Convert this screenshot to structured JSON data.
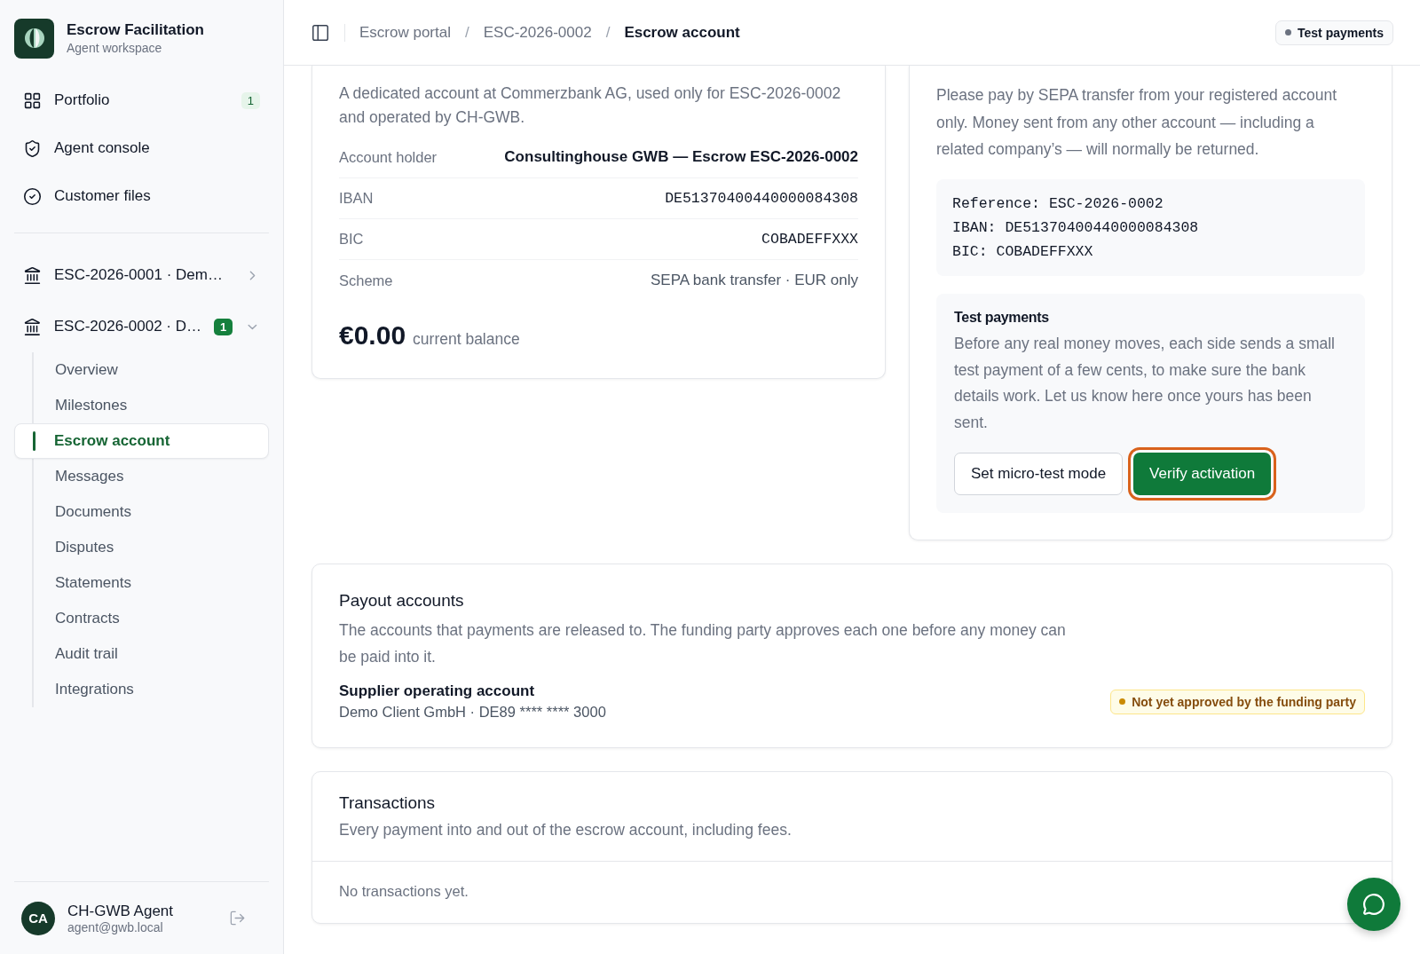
{
  "sidebar": {
    "brand": {
      "title": "Escrow Facilitation",
      "subtitle": "Agent workspace"
    },
    "nav": [
      {
        "label": "Portfolio",
        "badge": "1"
      },
      {
        "label": "Agent console"
      },
      {
        "label": "Customer files"
      }
    ],
    "projects": [
      {
        "label": "ESC-2026-0001 · Dem…",
        "expanded": false
      },
      {
        "label": "ESC-2026-0002 · D…",
        "badge": "1",
        "expanded": true,
        "children": [
          {
            "label": "Overview",
            "selected": false
          },
          {
            "label": "Milestones",
            "selected": false
          },
          {
            "label": "Escrow account",
            "selected": true
          },
          {
            "label": "Messages",
            "selected": false
          },
          {
            "label": "Documents",
            "selected": false
          },
          {
            "label": "Disputes",
            "selected": false
          },
          {
            "label": "Statements",
            "selected": false
          },
          {
            "label": "Contracts",
            "selected": false
          },
          {
            "label": "Audit trail",
            "selected": false
          },
          {
            "label": "Integrations",
            "selected": false
          }
        ]
      }
    ],
    "user": {
      "initials": "CA",
      "name": "CH-GWB Agent",
      "email": "agent@gwb.local"
    }
  },
  "header": {
    "breadcrumbs": [
      "Escrow portal",
      "ESC-2026-0002",
      "Escrow account"
    ],
    "mode_badge": "Test payments",
    "separator": "/"
  },
  "escrow_account": {
    "description": "A dedicated account at Commerzbank AG, used only for ESC-2026-0002 and operated by CH-GWB.",
    "fields": [
      {
        "label": "Account holder",
        "value": "Consultinghouse GWB — Escrow ESC-2026-0002",
        "kind": "strong"
      },
      {
        "label": "IBAN",
        "value": "DE51370400440000084308",
        "kind": "mono"
      },
      {
        "label": "BIC",
        "value": "COBADEFFXXX",
        "kind": "mono"
      },
      {
        "label": "Scheme",
        "value": "SEPA bank transfer · EUR only",
        "kind": "plain"
      }
    ],
    "balance": {
      "amount": "€0.00",
      "caption": "current balance"
    }
  },
  "funding_instructions": {
    "text": "Please pay by SEPA transfer from your registered account only. Money sent from any other account — including a related company’s — will normally be returned.",
    "reference_lines": [
      "Reference: ESC-2026-0002",
      "IBAN: DE51370400440000084308",
      "BIC: COBADEFFXXX"
    ],
    "test_payments": {
      "title": "Test payments",
      "text": "Before any real money moves, each side sends a small test payment of a few cents, to make sure the bank details work. Let us know here once yours has been sent.",
      "buttons": [
        {
          "label": "Set micro-test mode",
          "kind": "secondary",
          "focused": false
        },
        {
          "label": "Verify activation",
          "kind": "primary",
          "focused": true
        }
      ]
    }
  },
  "payout_accounts": {
    "title": "Payout accounts",
    "description": "The accounts that payments are released to. The funding party approves each one before any money can be paid into it.",
    "accounts": [
      {
        "name": "Supplier operating account",
        "detail": "Demo Client GmbH · DE89 **** **** 3000",
        "status": "Not yet approved by the funding party"
      }
    ]
  },
  "transactions": {
    "title": "Transactions",
    "description": "Every payment into and out of the escrow account, including fees.",
    "empty": "No transactions yet."
  }
}
